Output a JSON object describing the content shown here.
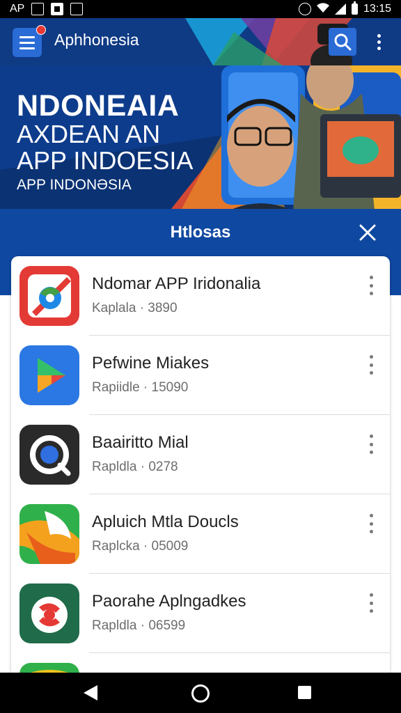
{
  "status_bar": {
    "left_text": "AP",
    "time": "13:15"
  },
  "app_bar": {
    "title": "Aphhonesia",
    "menu_icon": "menu-icon",
    "search_icon": "search-icon",
    "more_icon": "more-vert-icon",
    "color": "#0f3a84"
  },
  "banner": {
    "line1": "NDONEAIA",
    "line2": "AXDEAN AN",
    "line3": "APP INDOESIA",
    "subtitle": "APP INDONƏSIA"
  },
  "section": {
    "title": "Htlosas",
    "close_icon": "close-icon"
  },
  "apps": [
    {
      "name": "Ndomar APP Iridonalia",
      "meta": "Kaplala · 3890",
      "icon": "app-icon-red"
    },
    {
      "name": "Pefwine Miakes",
      "meta": "Rapiidle · 15090",
      "icon": "app-icon-play"
    },
    {
      "name": "Baairitto Mial",
      "meta": "Rapldla · 0278",
      "icon": "app-icon-search"
    },
    {
      "name": "Apluich Mtla Doucls",
      "meta": "Raplcka · 05009",
      "icon": "app-icon-green-orange"
    },
    {
      "name": "Paorahe Aplngadkes",
      "meta": "Rapldla · 06599",
      "icon": "app-icon-red-white"
    }
  ],
  "colors": {
    "primary": "#0f3a84",
    "accent": "#2a6bd6",
    "section": "#0f48a0"
  }
}
